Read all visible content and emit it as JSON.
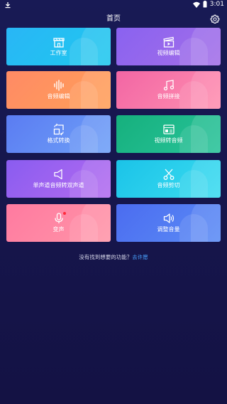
{
  "status_bar": {
    "time": "3:01"
  },
  "header": {
    "title": "首页"
  },
  "cards": [
    {
      "label": "工作室",
      "icon": "studio-icon"
    },
    {
      "label": "视频编辑",
      "icon": "clapperboard-icon"
    },
    {
      "label": "音频编辑",
      "icon": "waveform-icon"
    },
    {
      "label": "音频拼接",
      "icon": "music-note-icon"
    },
    {
      "label": "格式转换",
      "icon": "convert-icon"
    },
    {
      "label": "视频转音频",
      "icon": "video-to-audio-icon"
    },
    {
      "label": "单声道音频转双声道",
      "icon": "speaker-icon"
    },
    {
      "label": "音频剪切",
      "icon": "scissors-icon"
    },
    {
      "label": "变声",
      "icon": "microphone-icon",
      "badge": true
    },
    {
      "label": "调整音量",
      "icon": "volume-icon"
    }
  ],
  "feedback": {
    "text": "没有找到想要的功能？",
    "link": "去许愿"
  }
}
